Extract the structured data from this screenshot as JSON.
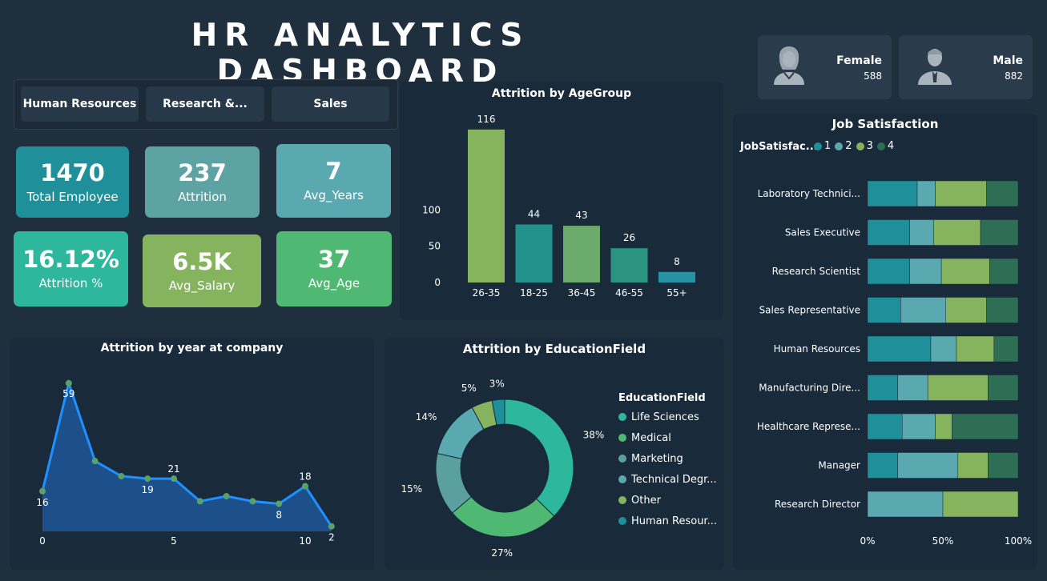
{
  "title": "HR ANALYTICS DASHBOARD",
  "departments": [
    "Human Resources",
    "Research &...",
    "Sales"
  ],
  "kpis": [
    {
      "value": "1470",
      "label": "Total Employee",
      "color": "#1f8f99"
    },
    {
      "value": "237",
      "label": "Attrition",
      "color": "#5ea3a4"
    },
    {
      "value": "7",
      "label": "Avg_Years",
      "color": "#5aa9b0"
    },
    {
      "value": "16.12%",
      "label": "Attrition %",
      "color": "#2db79c"
    },
    {
      "value": "6.5K",
      "label": "Avg_Salary",
      "color": "#86b45e"
    },
    {
      "value": "37",
      "label": "Avg_Age",
      "color": "#4fb973"
    }
  ],
  "gender": {
    "female": {
      "label": "Female",
      "value": "588"
    },
    "male": {
      "label": "Male",
      "value": "882"
    }
  },
  "age_chart": {
    "title": "Attrition by AgeGroup",
    "chart_data": {
      "type": "bar",
      "categories": [
        "26-35",
        "18-25",
        "36-45",
        "46-55",
        "55+"
      ],
      "values": [
        116,
        44,
        43,
        26,
        8
      ],
      "colors": [
        "#86b45e",
        "#21918c",
        "#6aaa6a",
        "#2a9480",
        "#2593a3"
      ],
      "yticks": [
        0,
        50,
        100
      ],
      "ylim": [
        0,
        125
      ]
    }
  },
  "year_chart": {
    "title": "Attrition by year at company",
    "chart_data": {
      "type": "area",
      "x": [
        0,
        1,
        2,
        3,
        4,
        5,
        6,
        7,
        8,
        9,
        10,
        11
      ],
      "y": [
        16,
        59,
        28,
        22,
        21,
        21,
        12,
        14,
        12,
        11,
        18,
        2
      ],
      "labels": {
        "0": "16",
        "1": "59",
        "4": "19",
        "5": "21",
        "9": "8",
        "10": "18",
        "11": "2"
      },
      "xticks": [
        0,
        5,
        10
      ],
      "ylim": [
        0,
        65
      ]
    }
  },
  "edu_chart": {
    "title": "Attrition by EducationField",
    "legend_title": "EducationField",
    "chart_data": {
      "type": "pie",
      "categories": [
        "Life Sciences",
        "Medical",
        "Marketing",
        "Technical Degr...",
        "Other",
        "Human Resour..."
      ],
      "values": [
        38,
        27,
        15,
        14,
        5,
        3
      ],
      "labels": [
        "38%",
        "27%",
        "15%",
        "14%",
        "5%",
        "3%"
      ],
      "colors": [
        "#2db79c",
        "#4fb973",
        "#5aa0a0",
        "#5aa9b0",
        "#86b45e",
        "#1f8f99"
      ]
    }
  },
  "job_chart": {
    "title": "Job Satisfaction",
    "legend_title": "JobSatisfac...",
    "legend": [
      {
        "label": "1",
        "color": "#1f8f99"
      },
      {
        "label": "2",
        "color": "#5aa9b0"
      },
      {
        "label": "3",
        "color": "#86b45e"
      },
      {
        "label": "4",
        "color": "#2d6e55"
      }
    ],
    "chart_data": {
      "type": "bar",
      "orientation": "horizontal-stacked-100",
      "categories": [
        "Laboratory Technici...",
        "Sales Executive",
        "Research Scientist",
        "Sales Representative",
        "Human Resources",
        "Manufacturing Dire...",
        "Healthcare Represe...",
        "Manager",
        "Research Director"
      ],
      "series": [
        {
          "name": "1",
          "values": [
            33,
            28,
            28,
            22,
            42,
            20,
            23,
            20,
            0
          ]
        },
        {
          "name": "2",
          "values": [
            12,
            16,
            21,
            30,
            17,
            20,
            22,
            40,
            50
          ]
        },
        {
          "name": "3",
          "values": [
            34,
            31,
            32,
            27,
            25,
            40,
            11,
            20,
            50
          ]
        },
        {
          "name": "4",
          "values": [
            21,
            25,
            19,
            21,
            16,
            20,
            44,
            20,
            0
          ]
        }
      ],
      "xticks": [
        "0%",
        "50%",
        "100%"
      ]
    }
  }
}
